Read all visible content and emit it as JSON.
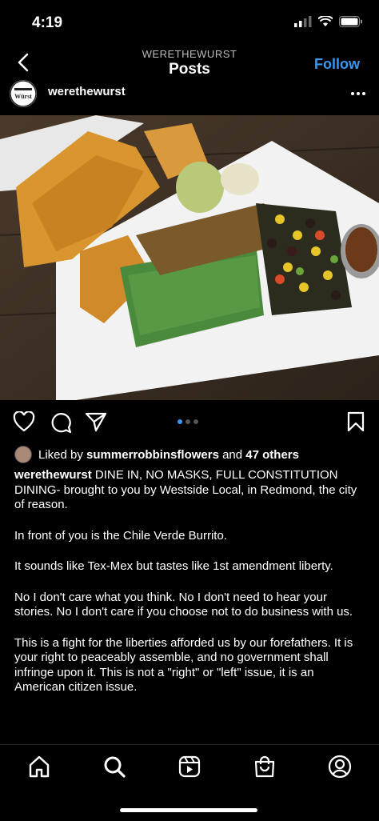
{
  "status": {
    "time": "4:19"
  },
  "nav": {
    "account": "WERETHEWURST",
    "title": "Posts",
    "follow_label": "Follow"
  },
  "post": {
    "username": "werethewurst",
    "avatar_text": "Würst",
    "likes_prefix": "Liked by ",
    "liked_by": "summerrobbinsflowers",
    "likes_suffix": " and ",
    "others": "47 others",
    "caption_user": "werethewurst",
    "caption_1": " DINE IN, NO MASKS, FULL CONSTITUTION DINING- brought to you by Westside Local, in Redmond, the city of reason.",
    "caption_2": "In front of you is the Chile Verde Burrito.",
    "caption_3": "It sounds like Tex-Mex but tastes like 1st amendment liberty.",
    "caption_4": "No I don't care what you think. No I don't need to hear your stories. No I don't care if you choose not to do business with us.",
    "caption_5": "This is a fight for the liberties afforded us by our forefathers. It is your right to peaceably assemble, and no government shall infringe upon it. This is not a \"right\" or \"left\" issue, it is an American citizen issue.",
    "carousel": {
      "current": 1,
      "total": 3
    }
  },
  "icons": [
    "back-icon",
    "more-icon",
    "heart-icon",
    "comment-icon",
    "share-icon",
    "bookmark-icon",
    "home-icon",
    "search-icon",
    "reels-icon",
    "shop-icon",
    "profile-icon"
  ],
  "colors": {
    "accent": "#3897f0",
    "background": "#000000"
  }
}
